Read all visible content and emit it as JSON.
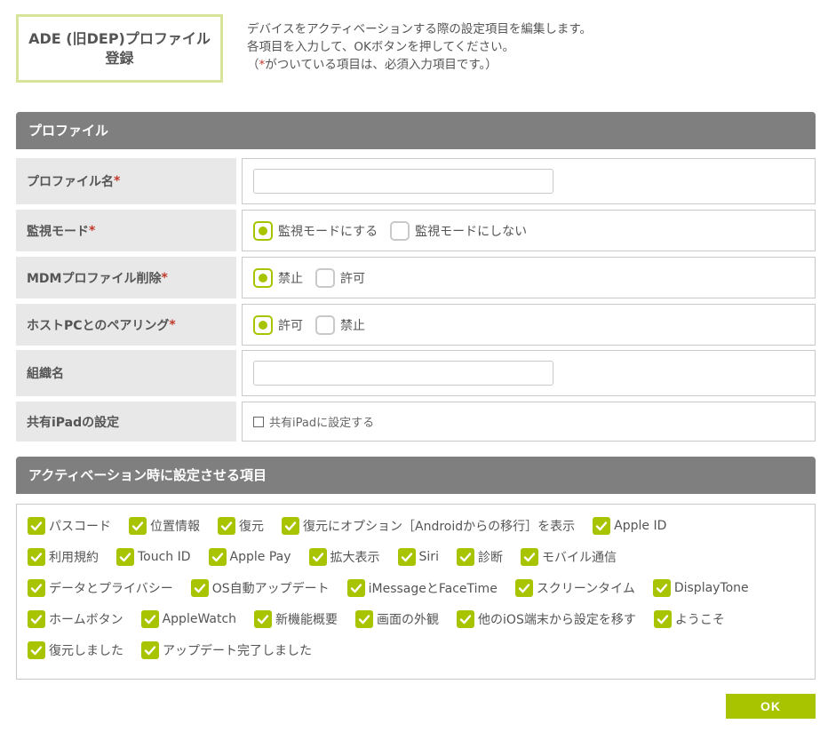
{
  "title": "ADE (旧DEP)プロファイル登録",
  "description": {
    "line1": "デバイスをアクティベーションする際の設定項目を編集します。",
    "line2": "各項目を入力して、OKボタンを押してください。",
    "line3_pre": "（",
    "line3_star": "*",
    "line3_post": "がついている項目は、必須入力項目です。）"
  },
  "profile_section": {
    "header": "プロファイル",
    "required_mark": "*",
    "profile_name": {
      "label": "プロファイル名",
      "value": "",
      "placeholder": ""
    },
    "supervision": {
      "label": "監視モード",
      "options": [
        "監視モードにする",
        "監視モードにしない"
      ],
      "selected": "監視モードにする"
    },
    "mdm_removal": {
      "label": "MDMプロファイル削除",
      "options": [
        "禁止",
        "許可"
      ],
      "selected": "禁止"
    },
    "host_pairing": {
      "label": "ホストPCとのペアリング",
      "options": [
        "許可",
        "禁止"
      ],
      "selected": "許可"
    },
    "org_name": {
      "label": "組織名",
      "value": "",
      "placeholder": ""
    },
    "shared_ipad": {
      "label": "共有iPadの設定",
      "checkbox_label": "共有iPadに設定する",
      "checked": false
    }
  },
  "activation_section": {
    "header": "アクティベーション時に設定させる項目",
    "rows": [
      [
        "パスコード",
        "位置情報",
        "復元",
        "復元にオプション［Androidからの移行］を表示",
        "Apple ID"
      ],
      [
        "利用規約",
        "Touch ID",
        "Apple Pay",
        "拡大表示",
        "Siri",
        "診断",
        "モバイル通信"
      ],
      [
        "データとプライバシー",
        "OS自動アップデート",
        "iMessageとFaceTime",
        "スクリーンタイム",
        "DisplayTone"
      ],
      [
        "ホームボタン",
        "AppleWatch",
        "新機能概要",
        "画面の外観",
        "他のiOS端末から設定を移す",
        "ようこそ"
      ],
      [
        "復元しました",
        "アップデート完了しました"
      ]
    ],
    "all_checked": true
  },
  "ok_button": "OK",
  "colors": {
    "accent": "#a8c400",
    "header_bg": "#7f7f7f",
    "title_border": "#d7e59a",
    "label_bg": "#e8e8e8",
    "required": "#c0392b"
  }
}
